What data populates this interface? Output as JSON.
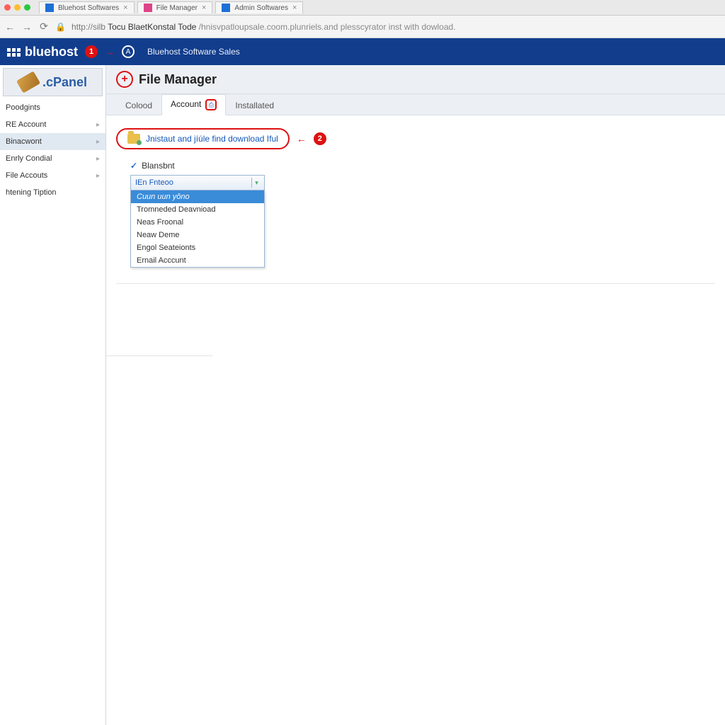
{
  "browser": {
    "tabs": [
      {
        "label": "Bluehost Softwares"
      },
      {
        "label": "File Manager"
      },
      {
        "label": "Admin Softwares"
      }
    ],
    "url_proto": "http://silb",
    "url_host": "Tocu BlaetKonstal Tode",
    "url_path": "/hnisvpatloupsale.coom.plunriels.and plesscyrator inst with dowload."
  },
  "bluebar": {
    "logo": "bluehost",
    "annot1": "1",
    "sub": "Bluehost Software Sales"
  },
  "cpanel": ".cPanel",
  "sidebar": {
    "items": [
      {
        "label": "Poodgints",
        "chev": false
      },
      {
        "label": "RE Account",
        "chev": true
      },
      {
        "label": "Binacwont",
        "chev": true,
        "active": true
      },
      {
        "label": "Enrly Condial",
        "chev": true
      },
      {
        "label": "File Accouts",
        "chev": true
      },
      {
        "label": "htening Tiption",
        "chev": false
      }
    ]
  },
  "page_title": "File Manager",
  "tabs": [
    {
      "label": "Colood",
      "active": false,
      "badge": false
    },
    {
      "label": "Account",
      "active": true,
      "badge": true
    },
    {
      "label": "Installated",
      "active": false,
      "badge": false
    }
  ],
  "callout": {
    "text": "Jnistaut and jíúle find download Iful",
    "annot": "2"
  },
  "section": {
    "head": "Blansbnt",
    "dd_value": "IEn Fnteoo",
    "options": [
      "Cuun uun yôno",
      "Tromneded Deavnioad",
      "Neas Froonal",
      "Neaw Deme",
      "Engol Seateionts",
      "Ernail Acccunt"
    ]
  }
}
